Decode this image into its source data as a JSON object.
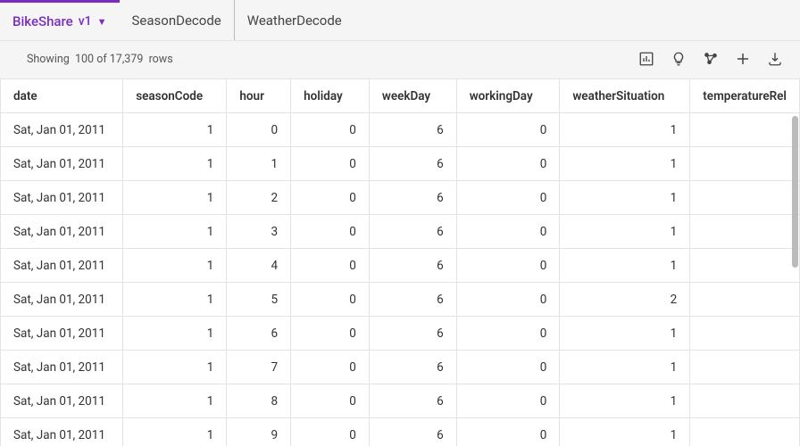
{
  "tabs": [
    {
      "label": "BikeShare",
      "version": "v1",
      "active": true
    },
    {
      "label": "SeasonDecode",
      "active": false
    },
    {
      "label": "WeatherDecode",
      "active": false
    }
  ],
  "rowcount": {
    "prefix": "Showing",
    "shown": "100",
    "of": "of 17,379",
    "suffix": "rows"
  },
  "columns": [
    "date",
    "seasonCode",
    "hour",
    "holiday",
    "weekDay",
    "workingDay",
    "weatherSituation",
    "temperatureRel"
  ],
  "rows": [
    {
      "date": "Sat, Jan 01, 2011",
      "seasonCode": 1,
      "hour": 0,
      "holiday": 0,
      "weekDay": 6,
      "workingDay": 0,
      "weatherSituation": 1
    },
    {
      "date": "Sat, Jan 01, 2011",
      "seasonCode": 1,
      "hour": 1,
      "holiday": 0,
      "weekDay": 6,
      "workingDay": 0,
      "weatherSituation": 1
    },
    {
      "date": "Sat, Jan 01, 2011",
      "seasonCode": 1,
      "hour": 2,
      "holiday": 0,
      "weekDay": 6,
      "workingDay": 0,
      "weatherSituation": 1
    },
    {
      "date": "Sat, Jan 01, 2011",
      "seasonCode": 1,
      "hour": 3,
      "holiday": 0,
      "weekDay": 6,
      "workingDay": 0,
      "weatherSituation": 1
    },
    {
      "date": "Sat, Jan 01, 2011",
      "seasonCode": 1,
      "hour": 4,
      "holiday": 0,
      "weekDay": 6,
      "workingDay": 0,
      "weatherSituation": 1
    },
    {
      "date": "Sat, Jan 01, 2011",
      "seasonCode": 1,
      "hour": 5,
      "holiday": 0,
      "weekDay": 6,
      "workingDay": 0,
      "weatherSituation": 2
    },
    {
      "date": "Sat, Jan 01, 2011",
      "seasonCode": 1,
      "hour": 6,
      "holiday": 0,
      "weekDay": 6,
      "workingDay": 0,
      "weatherSituation": 1
    },
    {
      "date": "Sat, Jan 01, 2011",
      "seasonCode": 1,
      "hour": 7,
      "holiday": 0,
      "weekDay": 6,
      "workingDay": 0,
      "weatherSituation": 1
    },
    {
      "date": "Sat, Jan 01, 2011",
      "seasonCode": 1,
      "hour": 8,
      "holiday": 0,
      "weekDay": 6,
      "workingDay": 0,
      "weatherSituation": 1
    },
    {
      "date": "Sat, Jan 01, 2011",
      "seasonCode": 1,
      "hour": 9,
      "holiday": 0,
      "weekDay": 6,
      "workingDay": 0,
      "weatherSituation": 1
    }
  ]
}
